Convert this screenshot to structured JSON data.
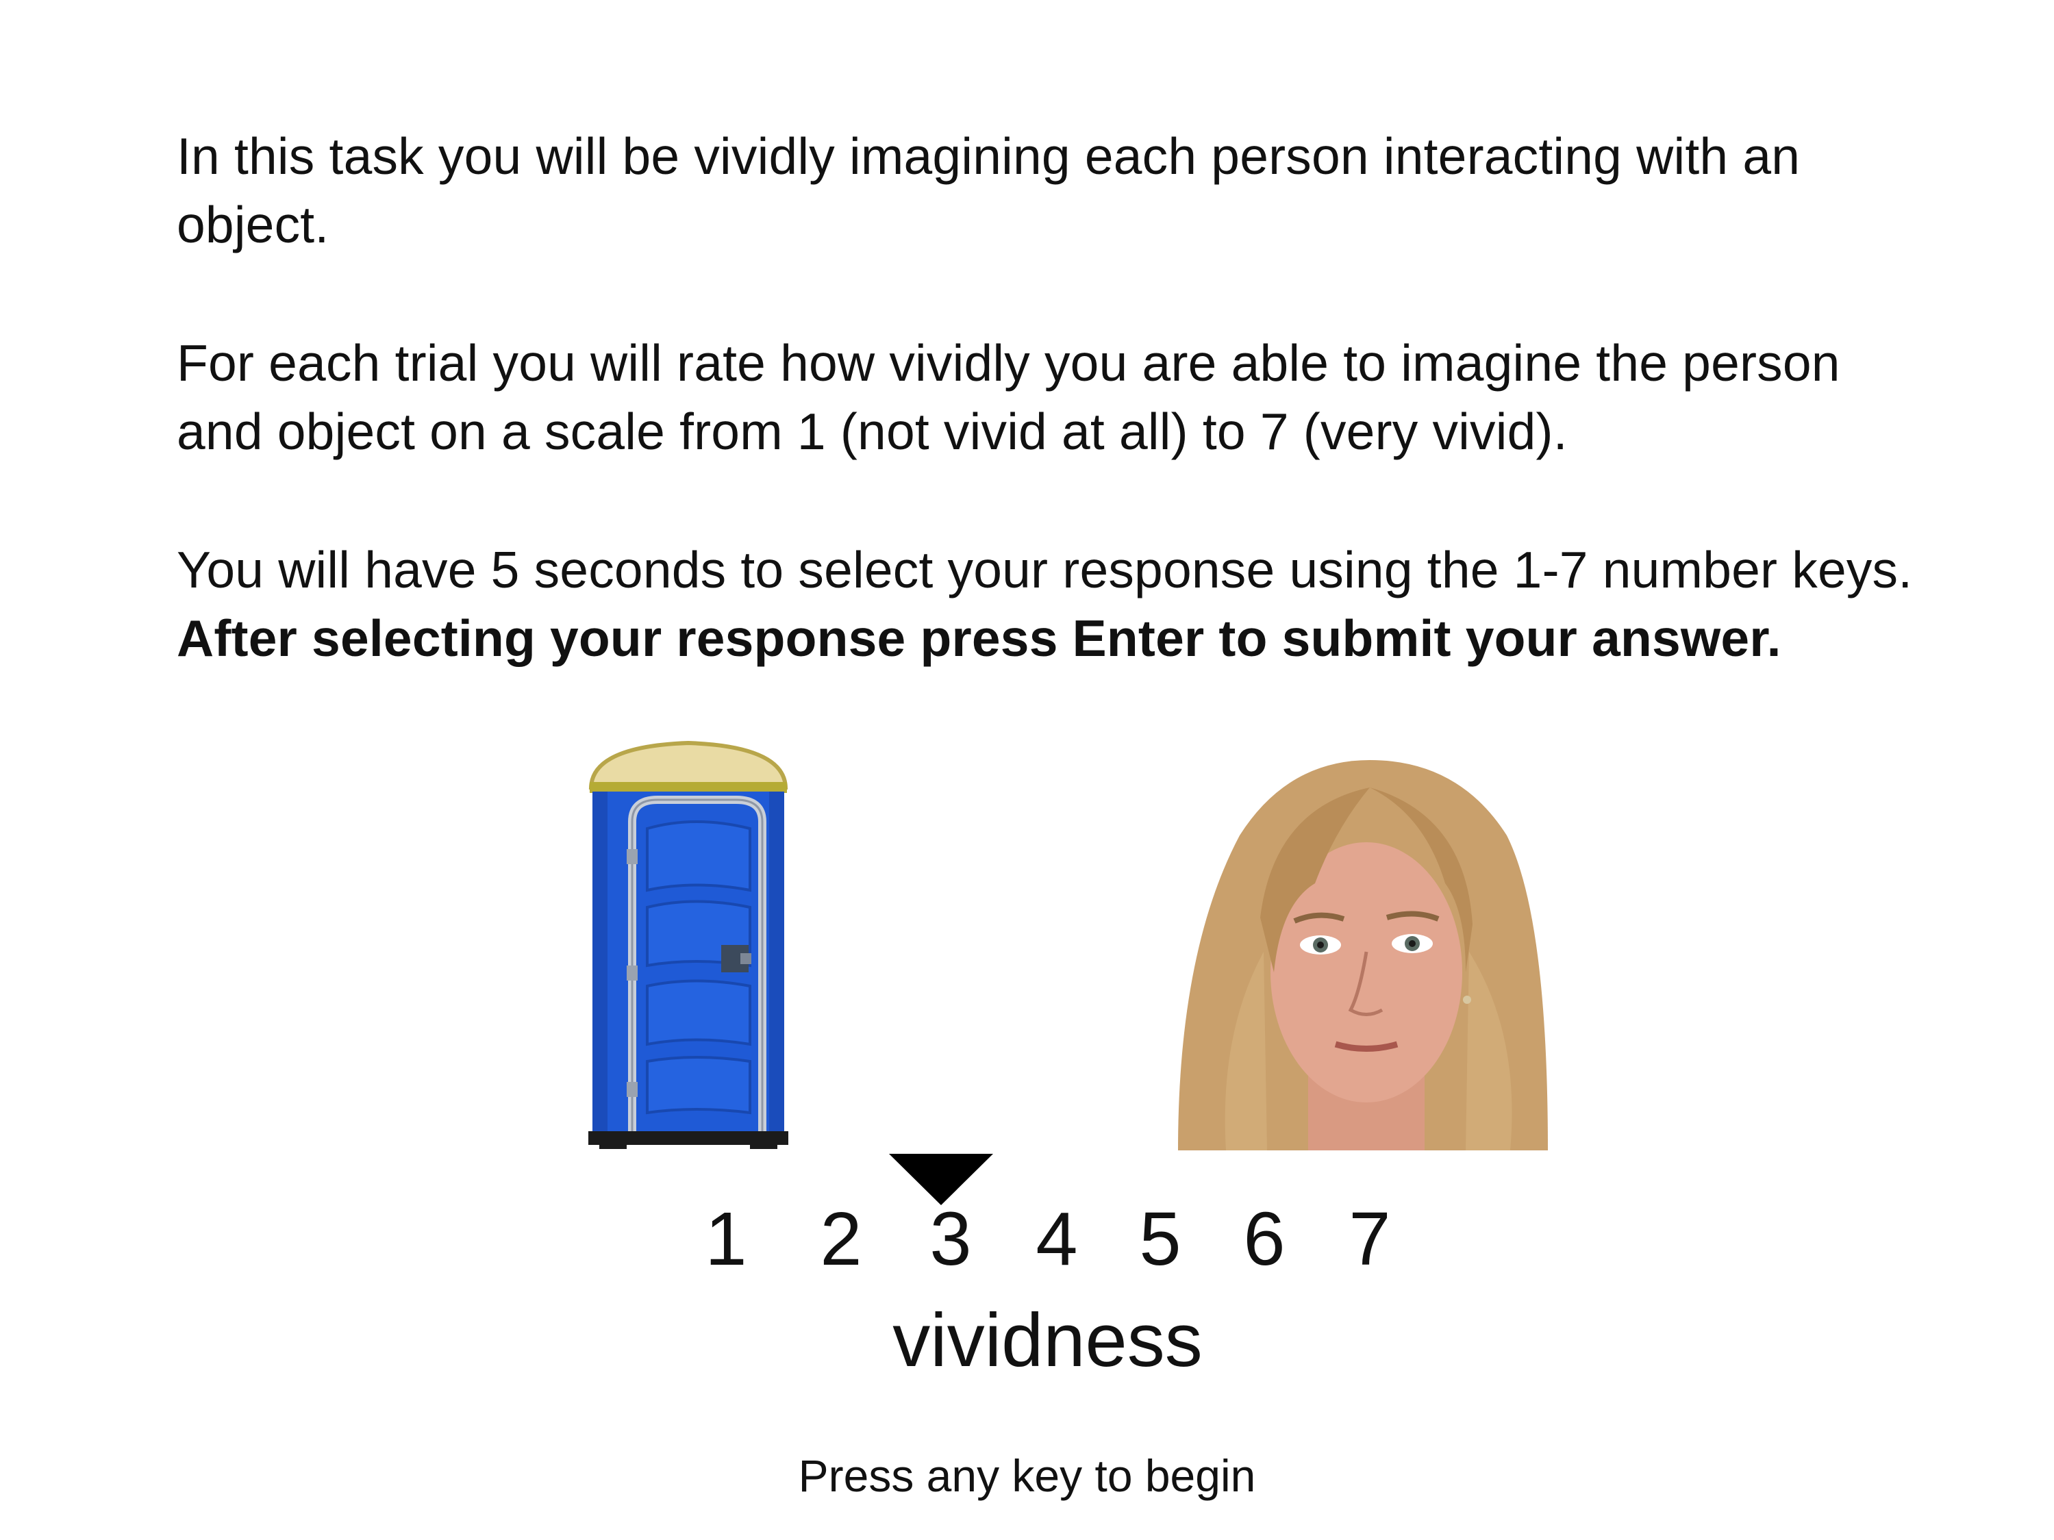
{
  "instructions": {
    "paragraph1": "In this task you will be vividly imagining each person interacting with an object.",
    "paragraph2": "For each trial you will rate how vividly you are able to imagine the person and object on a scale from 1 (not vivid at all) to 7 (very vivid).",
    "paragraph3_plain": "You will have 5 seconds to select your response using the 1-7 number keys. ",
    "paragraph3_bold": "After selecting your response press Enter to submit your answer."
  },
  "stimuli": {
    "object_icon": "portable-toilet-icon",
    "person_icon": "woman-face-photo"
  },
  "rating_scale": {
    "options": [
      "1",
      "2",
      "3",
      "4",
      "5",
      "6",
      "7"
    ],
    "selected": "3",
    "label": "vividness",
    "marker_icon": "down-triangle-icon"
  },
  "prompt": {
    "begin": "Press any key to begin"
  },
  "colors": {
    "text": "#111111",
    "background": "#ffffff",
    "toilet_blue": "#1f5ad6",
    "toilet_roof": "#e7d79a",
    "marker": "#000000"
  }
}
